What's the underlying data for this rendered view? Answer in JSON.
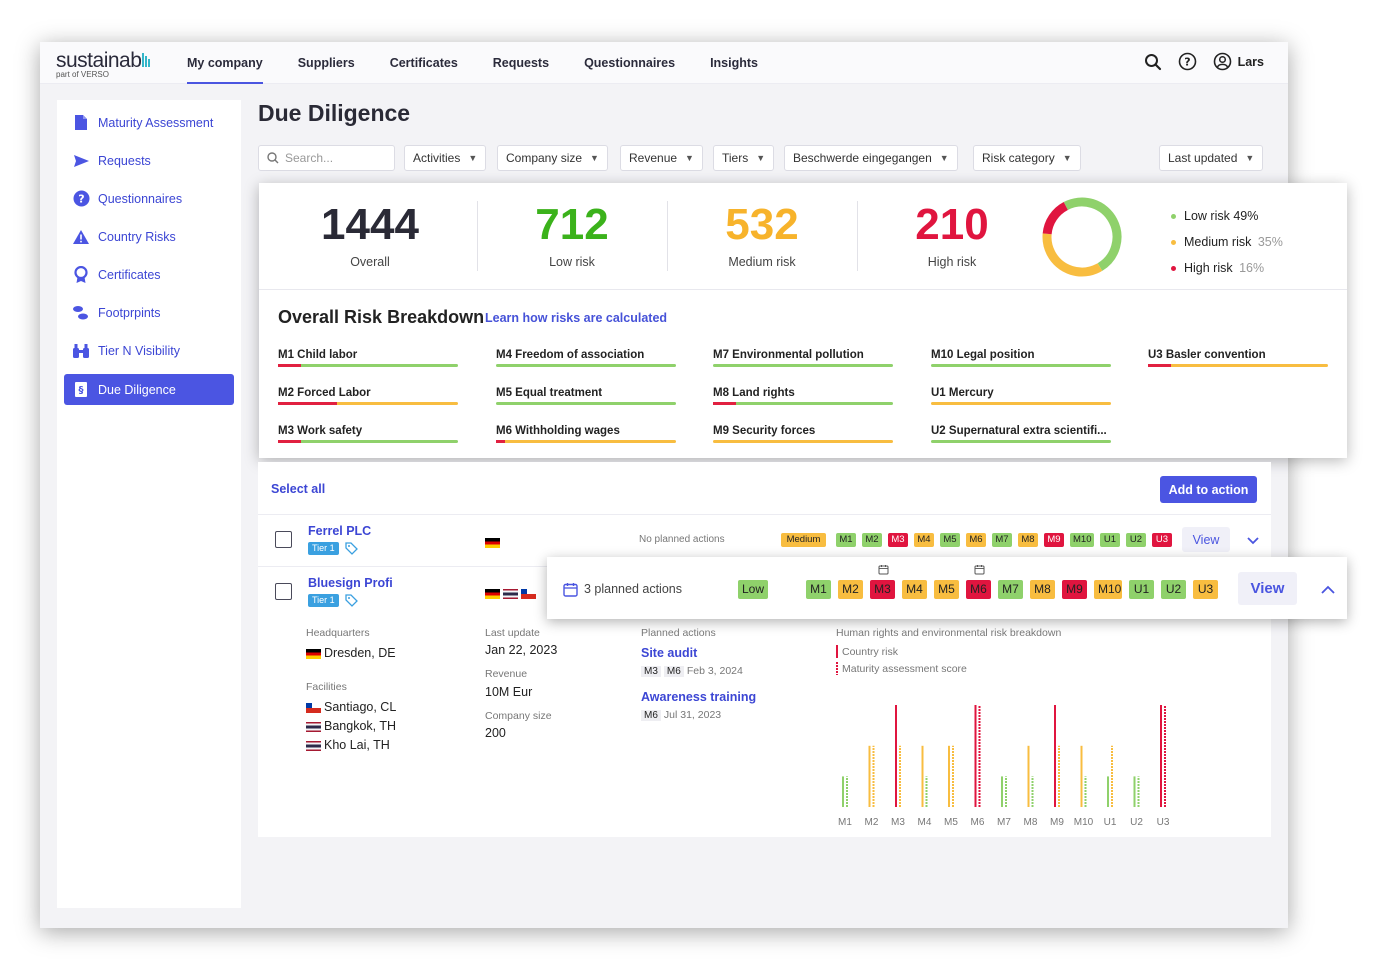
{
  "app": {
    "logo_text": "sustainab",
    "logo_sub": "part of VERSO",
    "nav": [
      "My company",
      "Suppliers",
      "Certificates",
      "Requests",
      "Questionnaires",
      "Insights"
    ],
    "user": "Lars",
    "accent": "#4b55e2"
  },
  "sidebar": {
    "items": [
      {
        "label": "Maturity Assessment",
        "icon": "document-icon"
      },
      {
        "label": "Requests",
        "icon": "send-icon"
      },
      {
        "label": "Questionnaires",
        "icon": "question-icon"
      },
      {
        "label": "Country Risks",
        "icon": "warning-icon"
      },
      {
        "label": "Certificates",
        "icon": "award-icon"
      },
      {
        "label": "Footprints",
        "icon": "footprint-icon"
      },
      {
        "label": "Tier N Visibility",
        "icon": "binoculars-icon"
      },
      {
        "label": "Due Diligence",
        "icon": "due-diligence-icon"
      }
    ],
    "sidebar_footprints_label": "Footprpints"
  },
  "page": {
    "title": "Due Diligence",
    "search_placeholder": "Search...",
    "filters": [
      "Activities",
      "Company size",
      "Revenue",
      "Tiers",
      "Beschwerde eingegangen",
      "Risk category"
    ],
    "sort": "Last updated"
  },
  "stats": {
    "overall": {
      "value": "1444",
      "label": "Overall"
    },
    "low": {
      "value": "712",
      "label": "Low risk"
    },
    "medium": {
      "value": "532",
      "label": "Medium risk"
    },
    "high": {
      "value": "210",
      "label": "High risk"
    },
    "legend": [
      {
        "label": "Low risk",
        "pct": "49%",
        "color": "#8fd16b"
      },
      {
        "label": "Medium risk",
        "pct": "35%",
        "color": "#f8bd40"
      },
      {
        "label": "High risk",
        "pct": "16%",
        "color": "#e0153f"
      }
    ],
    "donut": [
      49,
      35,
      16
    ]
  },
  "breakdown": {
    "title": "Overall Risk Breakdown",
    "link": "Learn how risks are calculated",
    "items": [
      {
        "label": "M1 Child labor",
        "color": "#8fd16b",
        "mark": 0.13
      },
      {
        "label": "M2 Forced Labor",
        "color": "#f8bd40",
        "mark": 0.33
      },
      {
        "label": "M3 Work safety",
        "color": "#8fd16b",
        "mark": 0.13
      },
      {
        "label": "M4 Freedom of association",
        "color": "#8fd16b",
        "mark": 0.0
      },
      {
        "label": "M5 Equal treatment",
        "color": "#8fd16b",
        "mark": 0.0
      },
      {
        "label": "M6 Withholding wages",
        "color": "#f8bd40",
        "mark": 0.05
      },
      {
        "label": "M7 Environmental pollution",
        "color": "#8fd16b",
        "mark": 0.0
      },
      {
        "label": "M8 Land rights",
        "color": "#8fd16b",
        "mark": 0.13
      },
      {
        "label": "M9 Security forces",
        "color": "#f8bd40",
        "mark": 0.0
      },
      {
        "label": "M10 Legal position",
        "color": "#8fd16b",
        "mark": 0.0
      },
      {
        "label": "U1 Mercury",
        "color": "#f8bd40",
        "mark": 0.0
      },
      {
        "label": "U2 Supernatural extra scientifi...",
        "color": "#8fd16b",
        "mark": 0.0
      },
      {
        "label": "U3 Basler convention",
        "color": "#f8bd40",
        "mark": 0.13
      }
    ]
  },
  "list": {
    "select_all": "Select all",
    "add_action": "Add to action",
    "suppliers": [
      {
        "name": "Ferrel PLC",
        "tier": "Tier 1",
        "planned": "No planned actions",
        "risk": "Medium",
        "view": "View"
      },
      {
        "name": "Bluesign Profi",
        "tier": "Tier 1",
        "planned": "3 planned actions",
        "risk": "Low",
        "view": "View"
      }
    ],
    "badges_row1": [
      {
        "t": "M1",
        "c": "g"
      },
      {
        "t": "M2",
        "c": "g"
      },
      {
        "t": "M3",
        "c": "r"
      },
      {
        "t": "M4",
        "c": "y"
      },
      {
        "t": "M5",
        "c": "g"
      },
      {
        "t": "M6",
        "c": "y"
      },
      {
        "t": "M7",
        "c": "g"
      },
      {
        "t": "M8",
        "c": "y"
      },
      {
        "t": "M9",
        "c": "r"
      },
      {
        "t": "M10",
        "c": "g"
      },
      {
        "t": "U1",
        "c": "g"
      },
      {
        "t": "U2",
        "c": "g"
      },
      {
        "t": "U3",
        "c": "r"
      }
    ],
    "badges_row2": [
      {
        "t": "M1",
        "c": "g"
      },
      {
        "t": "M2",
        "c": "y"
      },
      {
        "t": "M3",
        "c": "r"
      },
      {
        "t": "M4",
        "c": "y"
      },
      {
        "t": "M5",
        "c": "y"
      },
      {
        "t": "M6",
        "c": "r"
      },
      {
        "t": "M7",
        "c": "g"
      },
      {
        "t": "M8",
        "c": "y"
      },
      {
        "t": "M9",
        "c": "r"
      },
      {
        "t": "M10",
        "c": "y"
      },
      {
        "t": "U1",
        "c": "g"
      },
      {
        "t": "U2",
        "c": "g"
      },
      {
        "t": "U3",
        "c": "y"
      }
    ]
  },
  "details": {
    "hq_label": "Headquarters",
    "hq": "Dresden, DE",
    "facilities_label": "Facilities",
    "facilities": [
      "Santiago, CL",
      "Bangkok, TH",
      "Kho Lai, TH"
    ],
    "last_update_label": "Last update",
    "last_update": "Jan 22, 2023",
    "revenue_label": "Revenue",
    "revenue": "10M Eur",
    "size_label": "Company size",
    "size": "200",
    "planned_label": "Planned actions",
    "actions": [
      {
        "name": "Site audit",
        "tags": [
          "M3",
          "M6"
        ],
        "date": "Feb 3, 2024"
      },
      {
        "name": "Awareness training",
        "tags": [
          "M6"
        ],
        "date": "Jul 31, 2023"
      }
    ],
    "chart_title": "Human rights and environmental risk breakdown",
    "legend_country": "Country risk",
    "legend_maturity": "Maturity assessment score"
  },
  "chart_data": {
    "type": "bar",
    "title": "Human rights and environmental risk breakdown",
    "categories": [
      "M1",
      "M2",
      "M3",
      "M4",
      "M5",
      "M6",
      "M7",
      "M8",
      "M9",
      "M10",
      "U1",
      "U2",
      "U3"
    ],
    "series": [
      {
        "name": "Country risk",
        "values": [
          0.3,
          0.6,
          1.0,
          0.6,
          0.6,
          1.0,
          0.3,
          0.6,
          1.0,
          0.6,
          0.3,
          0.3,
          1.0
        ]
      },
      {
        "name": "Maturity assessment score",
        "values": [
          0.3,
          0.6,
          0.6,
          0.3,
          0.6,
          1.0,
          0.3,
          0.3,
          0.6,
          0.3,
          0.6,
          0.3,
          1.0
        ]
      }
    ],
    "colors": {
      "g": "#8fd16b",
      "y": "#f8bd40",
      "r": "#e0153f"
    },
    "ylim": [
      0,
      1
    ]
  }
}
